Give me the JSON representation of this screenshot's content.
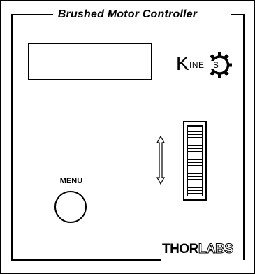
{
  "panel": {
    "title": "Brushed Motor Controller",
    "display_text": "",
    "brand": {
      "initial": "K",
      "rest": "INESIS",
      "gear_icon": "gear-icon"
    },
    "menu_label": "MENU",
    "footer_brand": {
      "bold": "THOR",
      "outline": "LABS"
    }
  },
  "colors": {
    "line": "#000000",
    "background": "#ffffff"
  }
}
